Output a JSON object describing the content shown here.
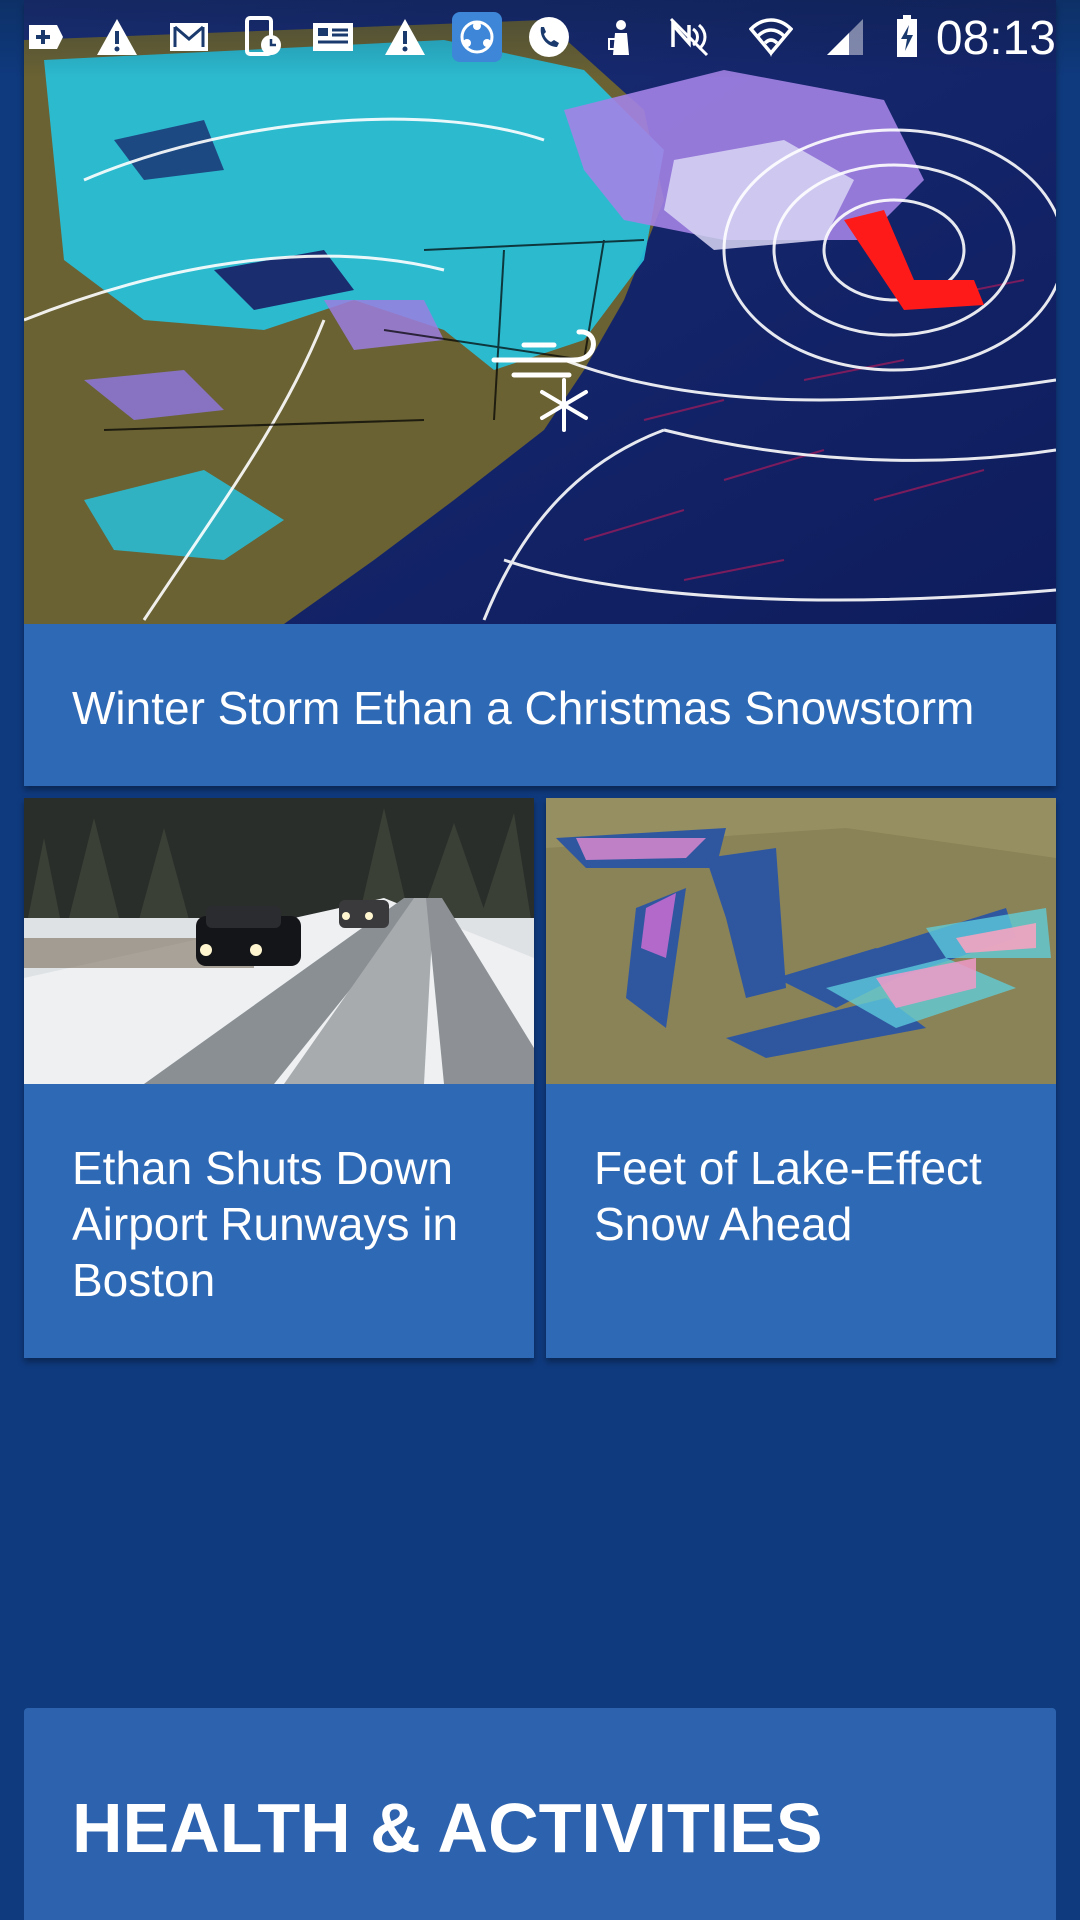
{
  "status_bar": {
    "time": "08:13",
    "icons": [
      "add-box-icon",
      "warning-icon",
      "gmail-icon",
      "device-clock-icon",
      "news-icon",
      "warning-icon",
      "share-app-icon",
      "phone-icon",
      "vpn-person-icon",
      "nfc-mute-icon",
      "wifi-icon",
      "signal-icon",
      "battery-charging-icon"
    ]
  },
  "feed": {
    "hero": {
      "title": "Winter Storm Ethan a Christmas Snowstorm",
      "image": "weather-map-northeast-snowstorm"
    },
    "cards": [
      {
        "title": "Ethan Shuts Down Airport Runways in Boston",
        "image": "snowy-road-cars"
      },
      {
        "title": "Feet of Lake-Effect Snow Ahead",
        "image": "great-lakes-radar-map"
      }
    ]
  },
  "sections": {
    "health": {
      "title": "HEALTH & ACTIVITIES"
    }
  },
  "colors": {
    "background": "#0f3a7e",
    "card": "#2e69b5",
    "text": "#ffffff"
  }
}
